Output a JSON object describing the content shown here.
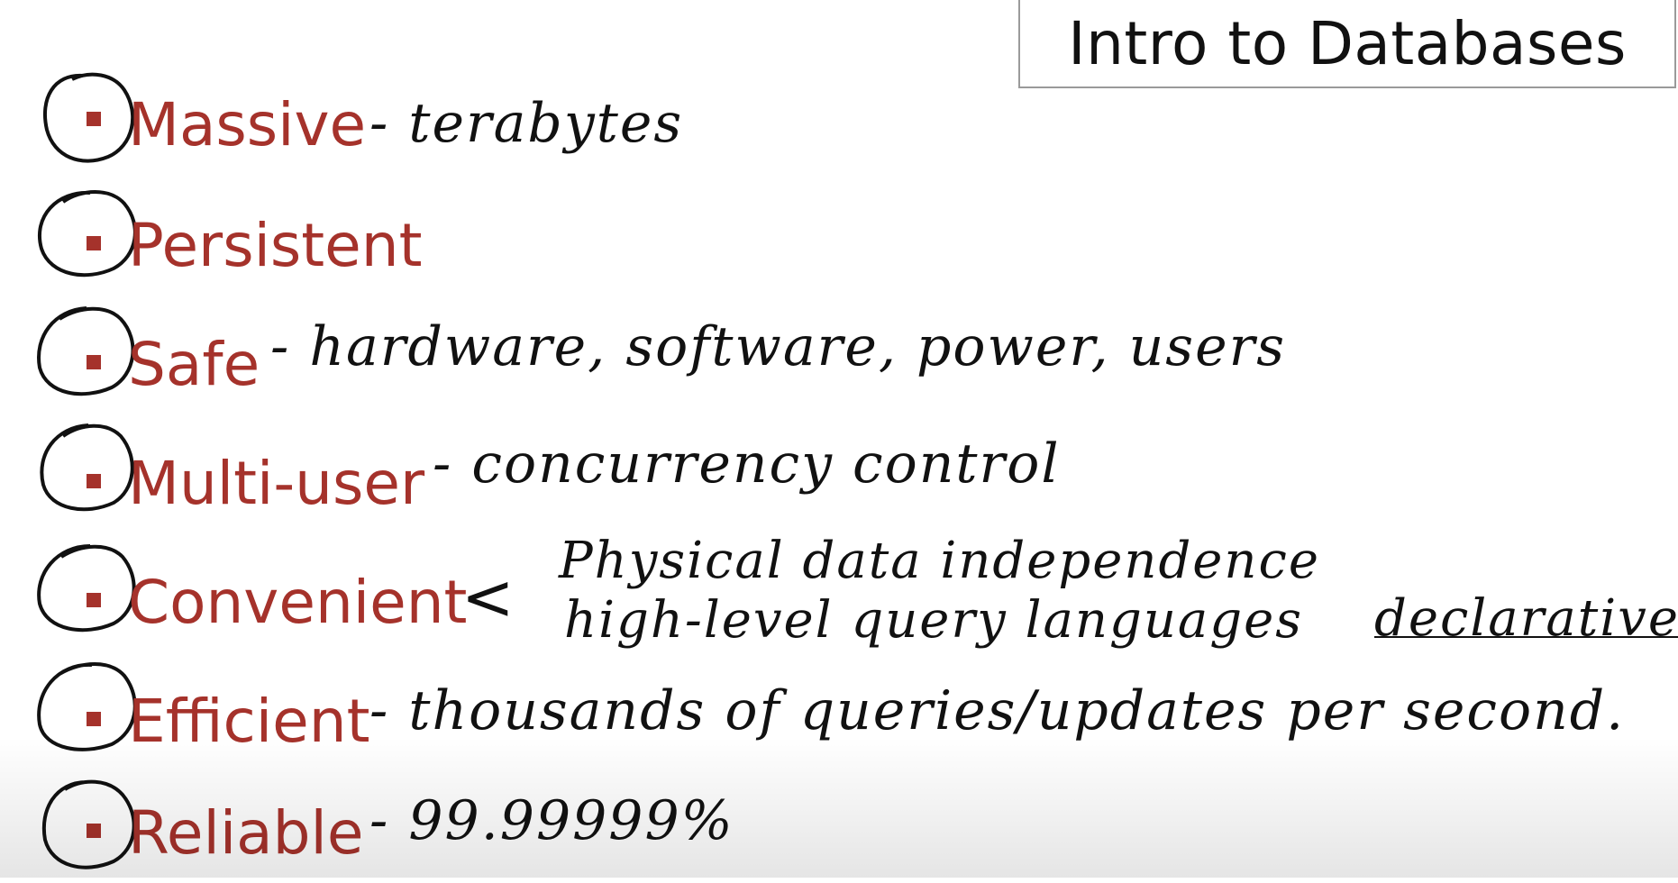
{
  "slide": {
    "title": "Intro to Databases",
    "accent_color": "#a5322b",
    "bullets": [
      {
        "term": "Massive",
        "note": "- terabytes"
      },
      {
        "term": "Persistent",
        "note": ""
      },
      {
        "term": "Safe",
        "note": "- hardware, software, power, users"
      },
      {
        "term": "Multi-user",
        "note": "- concurrency control"
      },
      {
        "term": "Convenient",
        "note": "<",
        "sub_notes": [
          "Physical data independence",
          "high-level query languages"
        ],
        "side_note": "declarative"
      },
      {
        "term": "Efficient",
        "note": "- thousands of queries/updates per second."
      },
      {
        "term": "Reliable",
        "note": "- 99.99999%"
      }
    ]
  }
}
